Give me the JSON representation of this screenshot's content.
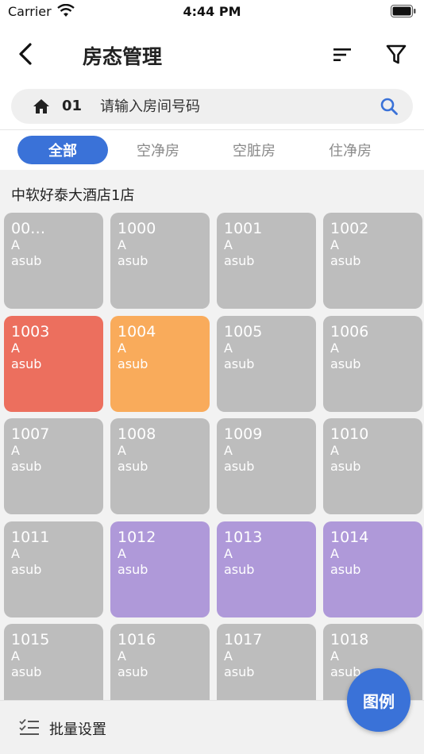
{
  "status_bar": {
    "carrier": "Carrier",
    "time": "4:44 PM"
  },
  "nav": {
    "title": "房态管理"
  },
  "search": {
    "building": "01",
    "placeholder": "请输入房间号码"
  },
  "tabs": [
    {
      "label": "全部",
      "active": true
    },
    {
      "label": "空净房",
      "active": false
    },
    {
      "label": "空脏房",
      "active": false
    },
    {
      "label": "住净房",
      "active": false
    }
  ],
  "hotel_name": "中软好泰大酒店1店",
  "rooms": [
    {
      "number": "00…",
      "type": "A",
      "sub": "asub",
      "status": "gray"
    },
    {
      "number": "1000",
      "type": "A",
      "sub": "asub",
      "status": "gray"
    },
    {
      "number": "1001",
      "type": "A",
      "sub": "asub",
      "status": "gray"
    },
    {
      "number": "1002",
      "type": "A",
      "sub": "asub",
      "status": "gray"
    },
    {
      "number": "1003",
      "type": "A",
      "sub": "asub",
      "status": "red"
    },
    {
      "number": "1004",
      "type": "A",
      "sub": "asub",
      "status": "orange"
    },
    {
      "number": "1005",
      "type": "A",
      "sub": "asub",
      "status": "gray"
    },
    {
      "number": "1006",
      "type": "A",
      "sub": "asub",
      "status": "gray"
    },
    {
      "number": "1007",
      "type": "A",
      "sub": "asub",
      "status": "gray"
    },
    {
      "number": "1008",
      "type": "A",
      "sub": "asub",
      "status": "gray"
    },
    {
      "number": "1009",
      "type": "A",
      "sub": "asub",
      "status": "gray"
    },
    {
      "number": "1010",
      "type": "A",
      "sub": "asub",
      "status": "gray"
    },
    {
      "number": "1011",
      "type": "A",
      "sub": "asub",
      "status": "gray"
    },
    {
      "number": "1012",
      "type": "A",
      "sub": "asub",
      "status": "purple"
    },
    {
      "number": "1013",
      "type": "A",
      "sub": "asub",
      "status": "purple"
    },
    {
      "number": "1014",
      "type": "A",
      "sub": "asub",
      "status": "purple"
    },
    {
      "number": "1015",
      "type": "A",
      "sub": "asub",
      "status": "gray"
    },
    {
      "number": "1016",
      "type": "A",
      "sub": "asub",
      "status": "gray"
    },
    {
      "number": "1017",
      "type": "A",
      "sub": "asub",
      "status": "gray"
    },
    {
      "number": "1018",
      "type": "A",
      "sub": "asub",
      "status": "gray"
    }
  ],
  "bottom": {
    "batch_label": "批量设置"
  },
  "fab": {
    "legend_label": "图例"
  },
  "colors": {
    "accent": "#3a72d8",
    "gray_room": "#bdbdbd",
    "red_room": "#ec6f5e",
    "orange_room": "#f9ab5b",
    "purple_room": "#af99d9"
  }
}
